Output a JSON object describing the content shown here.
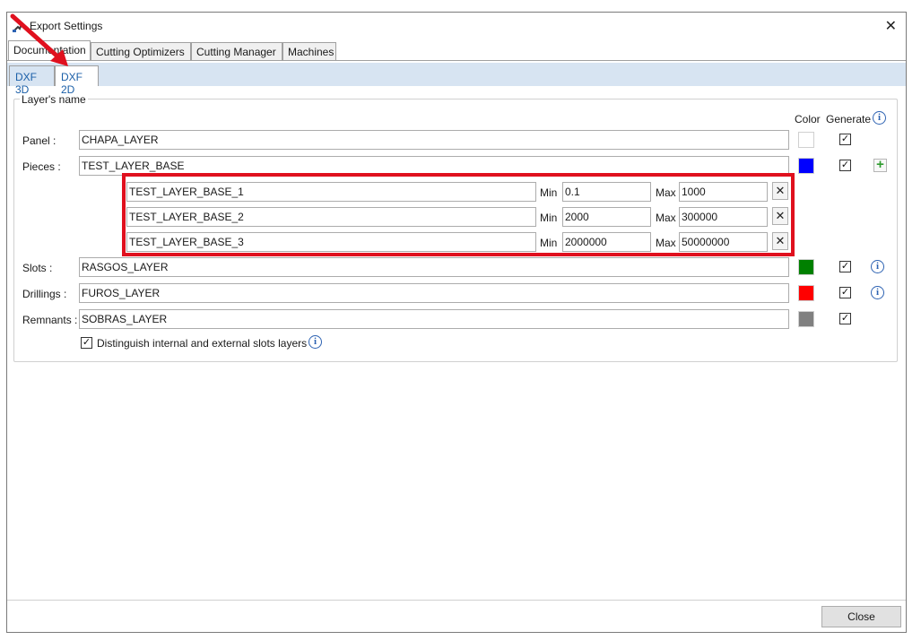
{
  "window": {
    "title": "Export Settings",
    "close_icon": "close-icon"
  },
  "tabs": [
    "Documentation",
    "Cutting Optimizers",
    "Cutting Manager",
    "Machines"
  ],
  "subtabs": [
    "DXF 3D",
    "DXF 2D"
  ],
  "group": {
    "legend": "Layer's name",
    "color_header": "Color",
    "generate_header": "Generate"
  },
  "rows": {
    "panel": {
      "label": "Panel :",
      "value": "CHAPA_LAYER",
      "color": "#ffffff",
      "generate": true
    },
    "pieces": {
      "label": "Pieces :",
      "value": "TEST_LAYER_BASE",
      "color": "#0000ff",
      "generate": true
    },
    "slots": {
      "label": "Slots :",
      "value": "RASGOS_LAYER",
      "color": "#008000",
      "generate": true
    },
    "drillings": {
      "label": "Drillings :",
      "value": "FUROS_LAYER",
      "color": "#ff0000",
      "generate": true
    },
    "remnants": {
      "label": "Remnants :",
      "value": "SOBRAS_LAYER",
      "color": "#808080",
      "generate": true
    }
  },
  "sublayers": [
    {
      "name": "TEST_LAYER_BASE_1",
      "min_label": "Min",
      "min": "0.1",
      "max_label": "Max",
      "max": "1000"
    },
    {
      "name": "TEST_LAYER_BASE_2",
      "min_label": "Min",
      "min": "2000",
      "max_label": "Max",
      "max": "300000"
    },
    {
      "name": "TEST_LAYER_BASE_3",
      "min_label": "Min",
      "min": "2000000",
      "max_label": "Max",
      "max": "50000000"
    }
  ],
  "distinguish": {
    "label": "Distinguish internal and external slots layers",
    "checked": true
  },
  "footer": {
    "close_label": "Close"
  },
  "glyphs": {
    "check": "✓",
    "info": "i",
    "plus": "+",
    "remove": "✕"
  },
  "annotations": {
    "highlight_color": "#e0101e",
    "arrow_color": "#e0101e"
  }
}
